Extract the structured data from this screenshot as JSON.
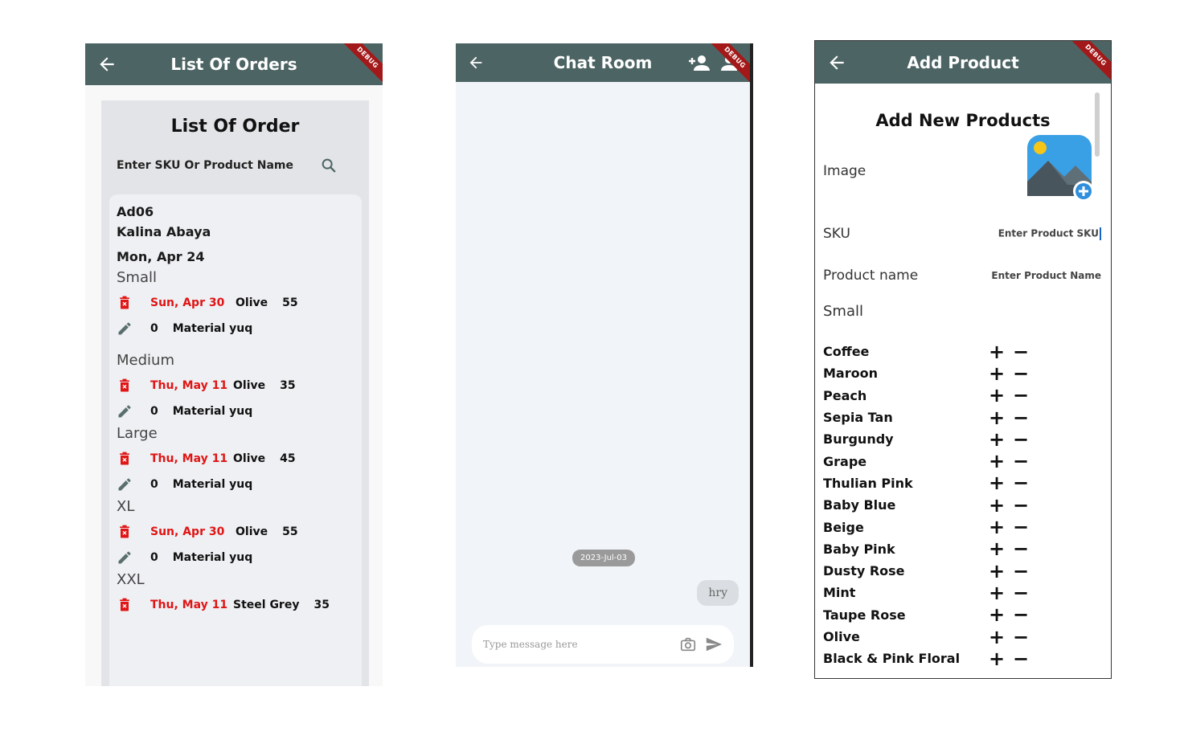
{
  "orders_screen": {
    "title": "List Of Orders",
    "debug": "DEBUG",
    "header": "List Of Order",
    "search_placeholder": "Enter SKU Or Product Name",
    "order": {
      "sku": "Ad06",
      "name": "Kalina Abaya",
      "date": "Mon, Apr 24",
      "sizes": [
        {
          "label": "Small",
          "due": "Sun, Apr 30",
          "color": "Olive",
          "qty": "55",
          "count": "0",
          "material": "Material yuq"
        },
        {
          "label": "Medium",
          "due": "Thu, May 11",
          "color": "Olive",
          "qty": "35",
          "count": "0",
          "material": "Material yuq"
        },
        {
          "label": "Large",
          "due": "Thu, May 11",
          "color": "Olive",
          "qty": "45",
          "count": "0",
          "material": "Material yuq"
        },
        {
          "label": "XL",
          "due": "Sun, Apr 30",
          "color": "Olive",
          "qty": "55",
          "count": "0",
          "material": "Material yuq"
        },
        {
          "label": "XXL",
          "due": "Thu, May 11",
          "color": "Steel Grey",
          "qty": "35"
        }
      ]
    }
  },
  "chat_screen": {
    "title": "Chat Room",
    "debug": "DEBUG",
    "date_chip": "2023-Jul-03",
    "message": "hry",
    "input_placeholder": "Type message here"
  },
  "product_screen": {
    "title": "Add Product",
    "debug": "DEBUG",
    "heading": "Add New Products",
    "image_label": "Image",
    "sku_label": "SKU",
    "sku_placeholder": "Enter Product SKU",
    "name_label": "Product name",
    "name_placeholder": "Enter Product Name",
    "size_label": "Small",
    "plus": "+",
    "minus": "−",
    "colors": [
      "Coffee",
      "Maroon",
      "Peach",
      "Sepia Tan",
      "Burgundy",
      "Grape",
      "Thulian Pink",
      "Baby Blue",
      "Beige",
      "Baby Pink",
      "Dusty Rose",
      "Mint",
      "Taupe Rose",
      "Olive",
      "Black & Pink Floral"
    ]
  },
  "theme": {
    "appbar": "#4d6464",
    "accent_red": "#e01515",
    "debug_banner": "#a31818"
  }
}
